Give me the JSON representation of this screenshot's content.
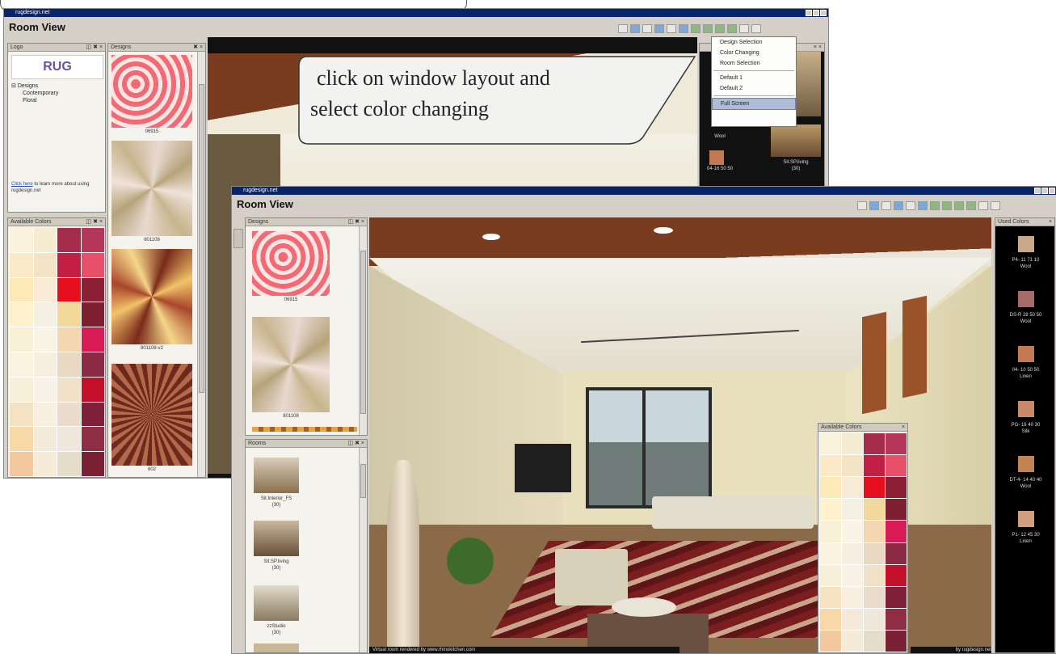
{
  "back_window": {
    "titlebar": "rugdesign.net",
    "app_title": "Room View",
    "logo_panel": {
      "header": "Logo",
      "brand_text": "RUG",
      "tree_root": "Designs",
      "tree_items": [
        "Contemporary",
        "Floral"
      ],
      "help_link": "Click here",
      "help_text": "to learn more about using rugdesign.net"
    },
    "designs_panel": {
      "header": "Designs",
      "items": [
        "06915",
        "801108",
        "801108-v2",
        "802"
      ]
    },
    "available_colors": {
      "header": "Available Colors"
    },
    "window_menu": {
      "items": [
        "Design Selection",
        "Color Changing",
        "Room Selection"
      ],
      "items2": [
        "Default 1",
        "Default 2"
      ],
      "highlighted": "Full Screen"
    },
    "right_panel": {
      "swatch_code": "04-16 50 50",
      "swatch_material": "Wool",
      "room_label": "Sit.SP.living",
      "room_count": "(30)"
    }
  },
  "callout": {
    "line1": "click on window layout and",
    "line2": "select color changing"
  },
  "front_window": {
    "titlebar": "rugdesign.net",
    "app_title": "Room View",
    "designs_panel": {
      "header": "Designs",
      "items": [
        "06915",
        "801108"
      ]
    },
    "rooms_panel": {
      "header": "Rooms",
      "items": [
        {
          "name": "Sit.Interior_FS",
          "count": "(30)"
        },
        {
          "name": "Sit.SP.living",
          "count": "(30)"
        },
        {
          "name": "zzStudio",
          "count": "(30)"
        }
      ]
    },
    "used_colors": {
      "header": "Used Colors",
      "items": [
        {
          "code": "P4- 11 71 10",
          "material": "Wool",
          "color": "#c8a98c"
        },
        {
          "code": "DS-R 28 50 50",
          "material": "Wool",
          "color": "#a86a68"
        },
        {
          "code": "04- 10 50 50",
          "material": "Linen",
          "color": "#c27a55"
        },
        {
          "code": "PG- 16 40 30",
          "material": "Silk",
          "color": "#c9896a"
        },
        {
          "code": "DT-4- 14 40 40",
          "material": "Wool",
          "color": "#c38455"
        },
        {
          "code": "P1- 12 45 30",
          "material": "Linen",
          "color": "#d0a07e"
        }
      ]
    },
    "floating_palette": {
      "header": "Available Colors"
    },
    "status_text": "Virtual room rendered by www.rhinokitchen.com",
    "status_right": "by rugdesign.net"
  },
  "palette_colors": [
    [
      "#faf2dc",
      "#f6ecd2",
      "#a62c4c",
      "#b8355a"
    ],
    [
      "#fbe9c8",
      "#f3e4c6",
      "#c21f45",
      "#e8506a"
    ],
    [
      "#fde8b8",
      "#f8ecd8",
      "#e60f1f",
      "#8a1f35"
    ],
    [
      "#fff1cc",
      "#f4f0e4",
      "#f2d89a",
      "#7c1f30"
    ],
    [
      "#f9f0d8",
      "#faf4e6",
      "#f4d6b0",
      "#d81b55"
    ],
    [
      "#fbf3df",
      "#f6efe1",
      "#ead9c2",
      "#8c2a44"
    ],
    [
      "#f7efd8",
      "#f7f1e8",
      "#f1e1c9",
      "#c5102c"
    ],
    [
      "#f5e2c2",
      "#f8efe0",
      "#e9dccc",
      "#7e2038"
    ],
    [
      "#f8d7a8",
      "#f3eadb",
      "#efe7dc",
      "#8f2d45"
    ],
    [
      "#f3c89e",
      "#f6ead8",
      "#e5dcc9",
      "#7a2233"
    ]
  ],
  "colors": {
    "title_blue": "#0a246a",
    "chrome": "#d4d0c8",
    "wall": "#e8e2c8",
    "ceiling": "#f0eee6",
    "wood": "#8a4e2a"
  }
}
